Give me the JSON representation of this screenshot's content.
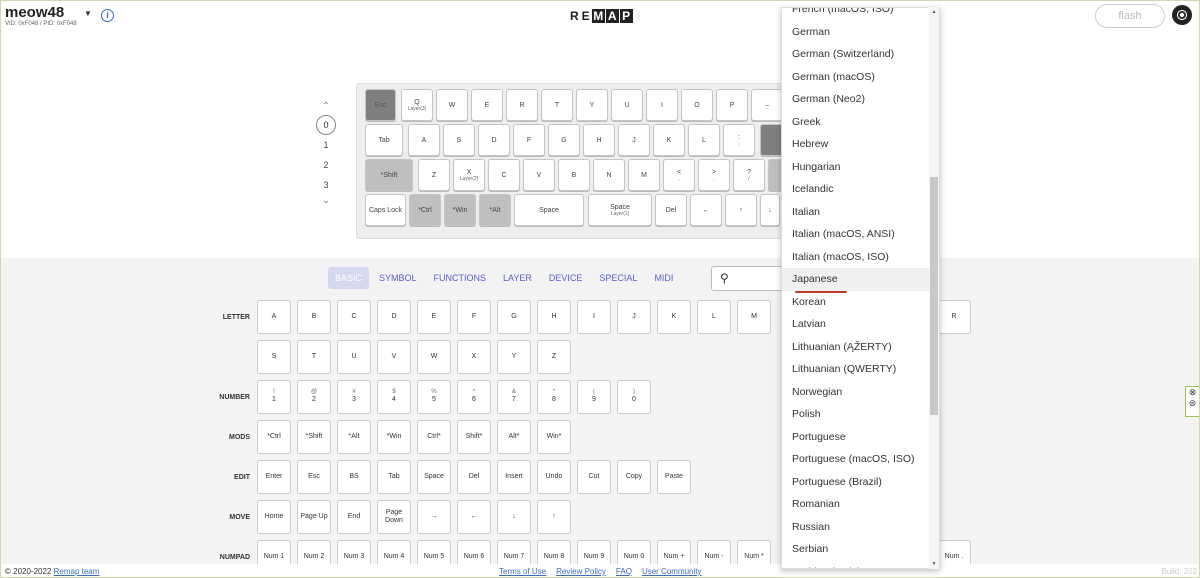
{
  "header": {
    "title": "meow48",
    "vidpid": "VID: 0xF048 / PID: 0xF048",
    "info": "i",
    "logo": [
      "R",
      "E",
      "M",
      "A",
      "P"
    ],
    "flash": "flash"
  },
  "layers": {
    "up": "⌃",
    "current": "0",
    "items": [
      "1",
      "2",
      "3"
    ],
    "down": "⌄"
  },
  "keyboard": {
    "row1": [
      {
        "l": "Esc",
        "s": ""
      },
      {
        "l": "Q",
        "s": "Layer(3)"
      },
      {
        "l": "W",
        "s": ""
      },
      {
        "l": "E",
        "s": ""
      },
      {
        "l": "R",
        "s": ""
      },
      {
        "l": "T",
        "s": ""
      },
      {
        "l": "Y",
        "s": ""
      },
      {
        "l": "U",
        "s": ""
      },
      {
        "l": "I",
        "s": ""
      },
      {
        "l": "O",
        "s": ""
      },
      {
        "l": "P",
        "s": ""
      },
      {
        "l": "_",
        "s": "-"
      }
    ],
    "row2": [
      {
        "l": "Tab",
        "s": ""
      },
      {
        "l": "A",
        "s": ""
      },
      {
        "l": "S",
        "s": ""
      },
      {
        "l": "D",
        "s": ""
      },
      {
        "l": "F",
        "s": ""
      },
      {
        "l": "G",
        "s": ""
      },
      {
        "l": "H",
        "s": ""
      },
      {
        "l": "J",
        "s": ""
      },
      {
        "l": "K",
        "s": ""
      },
      {
        "l": "L",
        "s": ""
      },
      {
        "l": ":",
        "s": ";"
      }
    ],
    "row3": [
      {
        "l": "*Shift",
        "s": ""
      },
      {
        "l": "Z",
        "s": ""
      },
      {
        "l": "X",
        "s": "Layer(2)"
      },
      {
        "l": "C",
        "s": ""
      },
      {
        "l": "V",
        "s": ""
      },
      {
        "l": "B",
        "s": ""
      },
      {
        "l": "N",
        "s": ""
      },
      {
        "l": "M",
        "s": ""
      },
      {
        "l": "<",
        "s": ","
      },
      {
        "l": ">",
        "s": "."
      },
      {
        "l": "?",
        "s": "/"
      }
    ],
    "row4": [
      {
        "l": "Caps Lock",
        "s": ""
      },
      {
        "l": "*Ctrl",
        "s": ""
      },
      {
        "l": "*Win",
        "s": ""
      },
      {
        "l": "*Alt",
        "s": ""
      },
      {
        "l": "Space",
        "s": ""
      },
      {
        "l": "Space",
        "s": "Layer(1)"
      },
      {
        "l": "Del",
        "s": ""
      },
      {
        "l": "←",
        "s": ""
      },
      {
        "l": "↑",
        "s": ""
      },
      {
        "l": "↓",
        "s": ""
      }
    ]
  },
  "tabs": [
    "BASIC",
    "SYMBOL",
    "FUNCTIONS",
    "LAYER",
    "DEVICE",
    "SPECIAL",
    "MIDI"
  ],
  "search_icon": "🔍",
  "categories": {
    "letter": "LETTER",
    "number": "NUMBER",
    "mods": "MODS",
    "edit": "EDIT",
    "move": "MOVE",
    "numpad": "NUMPAD"
  },
  "letters1": [
    "A",
    "B",
    "C",
    "D",
    "E",
    "F",
    "G",
    "H",
    "I",
    "J",
    "K",
    "L",
    "M",
    "R"
  ],
  "letters2": [
    "S",
    "T",
    "U",
    "V",
    "W",
    "X",
    "Y",
    "Z"
  ],
  "numbers": [
    {
      "t": "!",
      "b": "1"
    },
    {
      "t": "@",
      "b": "2"
    },
    {
      "t": "#",
      "b": "3"
    },
    {
      "t": "$",
      "b": "4"
    },
    {
      "t": "%",
      "b": "5"
    },
    {
      "t": "^",
      "b": "6"
    },
    {
      "t": "&",
      "b": "7"
    },
    {
      "t": "*",
      "b": "8"
    },
    {
      "t": "(",
      "b": "9"
    },
    {
      "t": ")",
      "b": "0"
    }
  ],
  "mods": [
    "*Ctrl",
    "*Shift",
    "*Alt",
    "*Win",
    "Ctrl*",
    "Shift*",
    "Alt*",
    "Win*"
  ],
  "edit": [
    "Enter",
    "Esc",
    "BS",
    "Tab",
    "Space",
    "Del",
    "Insert",
    "Undo",
    "Cut",
    "Copy",
    "Paste"
  ],
  "move": [
    "Home",
    "Page Up",
    "End",
    "Page Down",
    "→",
    "←",
    "↓",
    "↑"
  ],
  "numpad": [
    "Num 1",
    "Num 2",
    "Num 3",
    "Num 4",
    "Num 5",
    "Num 6",
    "Num 7",
    "Num 8",
    "Num 9",
    "Num 0",
    "Num +",
    "Num -",
    "Num *",
    "Num ."
  ],
  "dropdown": {
    "options": [
      "French (macOS, ISO)",
      "German",
      "German (Switzerland)",
      "German (macOS)",
      "German (Neo2)",
      "Greek",
      "Hebrew",
      "Hungarian",
      "Icelandic",
      "Italian",
      "Italian (macOS, ANSI)",
      "Italian (macOS, ISO)",
      "Japanese",
      "Korean",
      "Latvian",
      "Lithuanian (ĄŽERTY)",
      "Lithuanian (QWERTY)",
      "Norwegian",
      "Polish",
      "Portuguese",
      "Portuguese (macOS, ISO)",
      "Portuguese (Brazil)",
      "Romanian",
      "Russian",
      "Serbian",
      "Serbian (Latin)"
    ],
    "selected": "Japanese",
    "scroll_up": "▲",
    "scroll_down": "▼"
  },
  "side": [
    "⊗",
    "⊜"
  ],
  "footer": {
    "copyright": "© 2020-2022",
    "team": "Remap team",
    "links": [
      "Terms of Use",
      "Review Policy",
      "FAQ",
      "User Community"
    ],
    "build": "Build: 202"
  },
  "colors": {
    "accent": "#5a5fc8",
    "underline": "#c0392b"
  }
}
